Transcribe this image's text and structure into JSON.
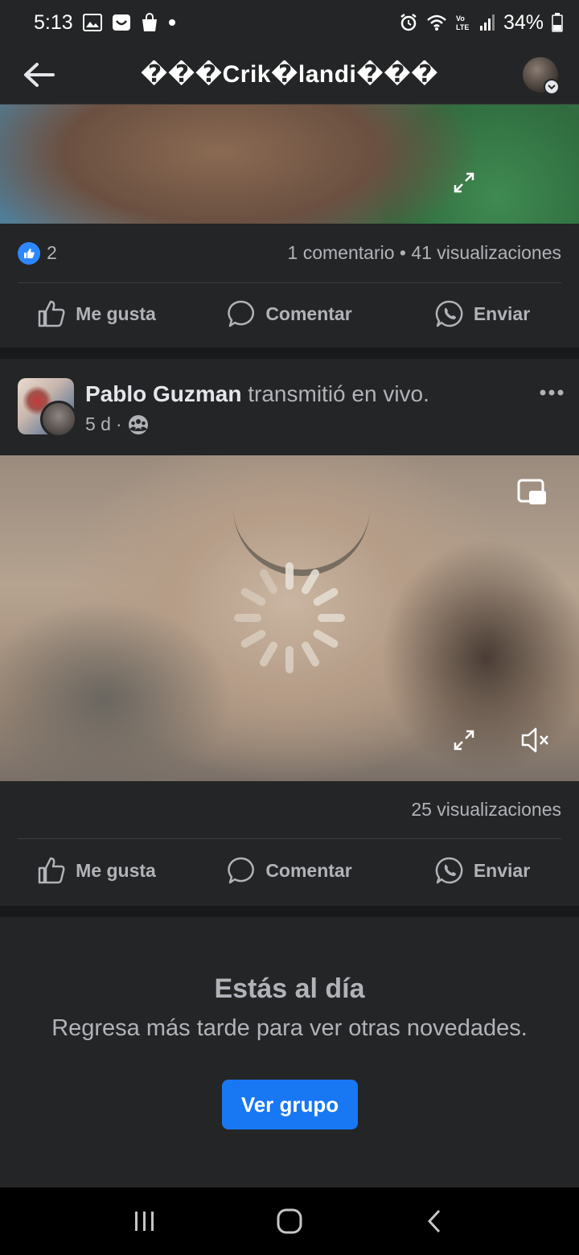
{
  "status_bar": {
    "time": "5:13",
    "battery": "34%",
    "icons": [
      "gallery-icon",
      "messenger-icon",
      "shopping-bag-icon",
      "dot-icon",
      "alarm-icon",
      "wifi-icon",
      "volte-icon",
      "signal-icon",
      "battery-icon"
    ]
  },
  "header": {
    "group_name": "���Crik�landi���"
  },
  "post1": {
    "reaction_count": "2",
    "stats": "1 comentario • 41 visualizaciones",
    "actions": {
      "like": "Me gusta",
      "comment": "Comentar",
      "send": "Enviar"
    }
  },
  "post2": {
    "author": "Pablo Guzman",
    "verb": "transmitió en vivo.",
    "time": "5 d",
    "time_separator": "·",
    "views": "25 visualizaciones",
    "actions": {
      "like": "Me gusta",
      "comment": "Comentar",
      "send": "Enviar"
    }
  },
  "feed_end": {
    "title": "Estás al día",
    "subtitle": "Regresa más tarde para ver otras novedades.",
    "button": "Ver grupo"
  },
  "colors": {
    "background": "#18191a",
    "card": "#242526",
    "primary_text": "#e4e6eb",
    "secondary_text": "#b0b3b8",
    "accent": "#1877f2"
  }
}
